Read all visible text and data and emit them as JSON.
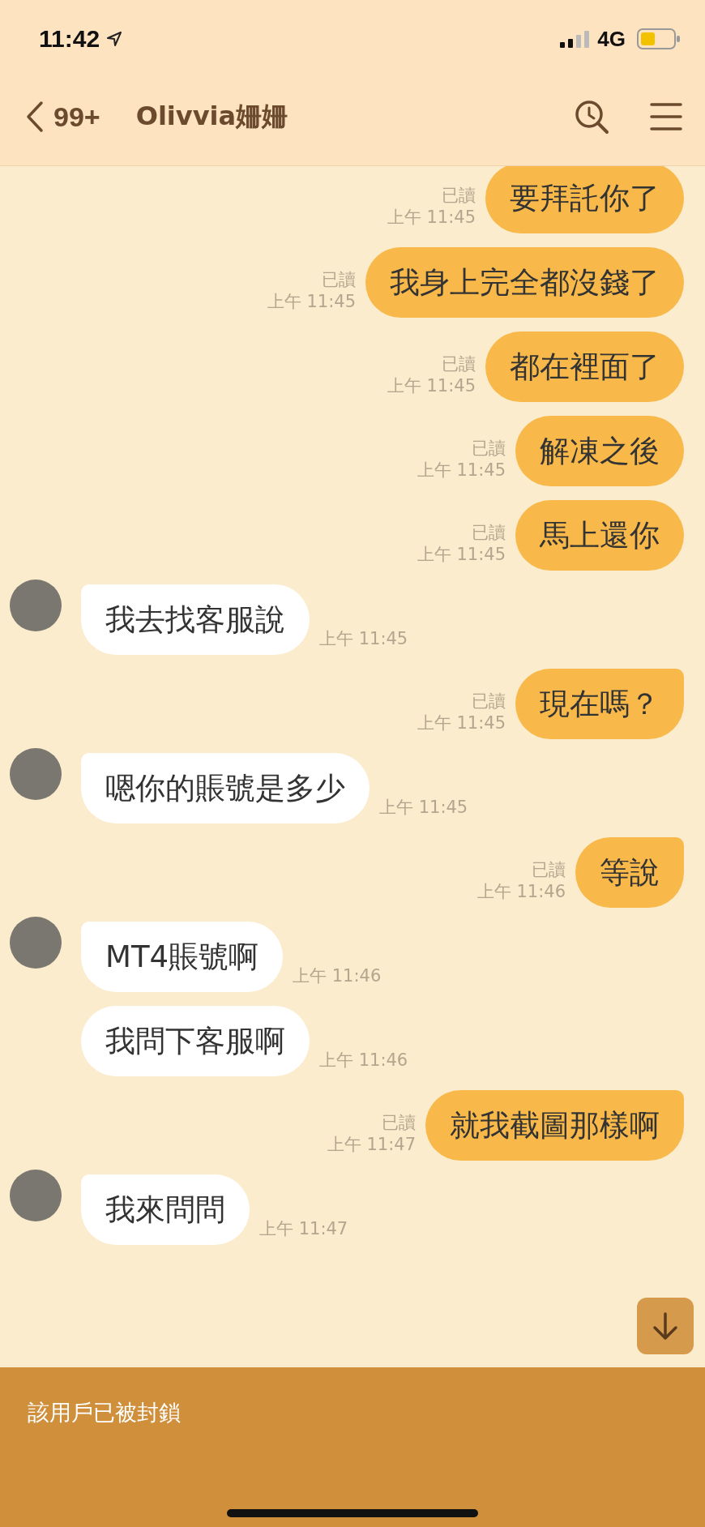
{
  "status_bar": {
    "time": "11:42",
    "network": "4G"
  },
  "header": {
    "back_count": "99+",
    "title": "Olivvia姍姍"
  },
  "messages": [
    {
      "kind": "sent",
      "text": "要拜託你了",
      "read": "已讀",
      "time": "上午 11:45",
      "tail": false
    },
    {
      "kind": "sent",
      "text": "我身上完全都沒錢了",
      "read": "已讀",
      "time": "上午 11:45",
      "tail": false
    },
    {
      "kind": "sent",
      "text": "都在裡面了",
      "read": "已讀",
      "time": "上午 11:45",
      "tail": false
    },
    {
      "kind": "sent",
      "text": "解凍之後",
      "read": "已讀",
      "time": "上午 11:45",
      "tail": false
    },
    {
      "kind": "sent",
      "text": "馬上還你",
      "read": "已讀",
      "time": "上午 11:45",
      "tail": false
    },
    {
      "kind": "received",
      "text": "我去找客服說",
      "time": "上午 11:45",
      "tail": true
    },
    {
      "kind": "sent",
      "text": "現在嗎？",
      "read": "已讀",
      "time": "上午 11:45",
      "tail": true
    },
    {
      "kind": "received",
      "text": "嗯你的賬號是多少",
      "time": "上午 11:45",
      "tail": true
    },
    {
      "kind": "sent",
      "text": "等說",
      "read": "已讀",
      "time": "上午 11:46",
      "tail": true
    },
    {
      "kind": "received",
      "text": "MT4賬號啊",
      "time": "上午 11:46",
      "tail": true
    },
    {
      "kind": "received",
      "text": "我問下客服啊",
      "time": "上午 11:46",
      "tail": false
    },
    {
      "kind": "sent",
      "text": "就我截圖那樣啊",
      "read": "已讀",
      "time": "上午 11:47",
      "tail": true
    },
    {
      "kind": "received",
      "text": "我來問問",
      "time": "上午 11:47",
      "tail": true
    }
  ],
  "blocked_notice": "該用戶已被封鎖"
}
